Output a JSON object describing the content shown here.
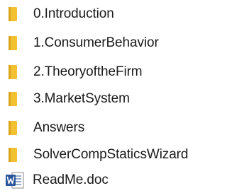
{
  "items": [
    {
      "label": "0.Introduction",
      "icon": "folder-icon"
    },
    {
      "label": "1.ConsumerBehavior",
      "icon": "folder-icon"
    },
    {
      "label": "2.TheoryoftheFirm",
      "icon": "folder-icon"
    },
    {
      "label": "3.MarketSystem",
      "icon": "folder-icon"
    },
    {
      "label": "Answers",
      "icon": "folder-icon"
    },
    {
      "label": "SolverCompStaticsWizard",
      "icon": "folder-icon"
    },
    {
      "label": "ReadMe.doc",
      "icon": "word-document-icon"
    }
  ],
  "colors": {
    "folder": "#f2c131",
    "folder_shade": "#d9a520",
    "word_blue": "#2b579a",
    "text": "#1a1a1a"
  }
}
